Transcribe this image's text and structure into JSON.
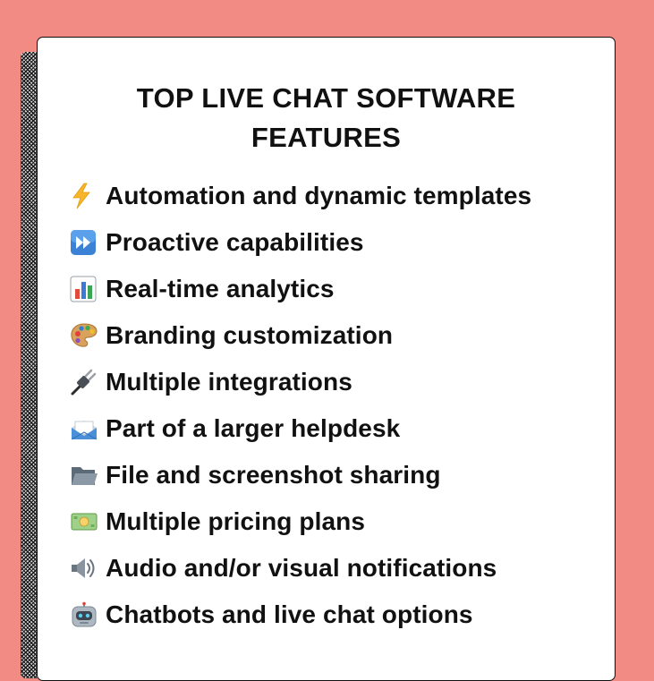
{
  "title": {
    "line1": "TOP LIVE CHAT SOFTWARE",
    "line2": "FEATURES"
  },
  "features": [
    {
      "icon": "lightning-icon",
      "label": "Automation and dynamic templates"
    },
    {
      "icon": "fast-forward-icon",
      "label": "Proactive capabilities"
    },
    {
      "icon": "bar-chart-icon",
      "label": "Real-time analytics"
    },
    {
      "icon": "palette-icon",
      "label": "Branding customization"
    },
    {
      "icon": "plug-icon",
      "label": "Multiple integrations"
    },
    {
      "icon": "envelope-icon",
      "label": "Part of a larger helpdesk"
    },
    {
      "icon": "folder-icon",
      "label": "File and screenshot sharing"
    },
    {
      "icon": "money-icon",
      "label": "Multiple pricing plans"
    },
    {
      "icon": "speaker-icon",
      "label": "Audio and/or visual notifications"
    },
    {
      "icon": "robot-icon",
      "label": "Chatbots and live chat options"
    }
  ],
  "colors": {
    "background": "#f28b84",
    "card": "#ffffff",
    "text": "#111111"
  }
}
